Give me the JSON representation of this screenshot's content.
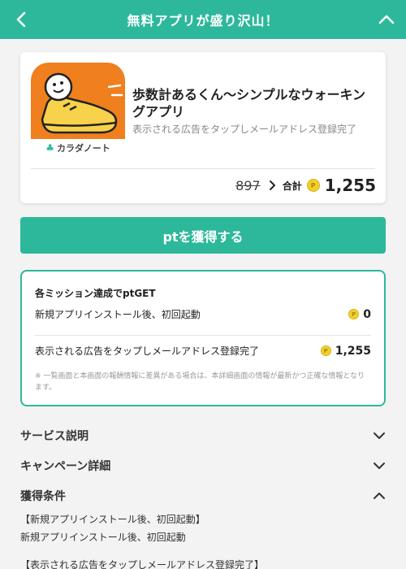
{
  "header": {
    "title": "無料アプリが盛り沢山！"
  },
  "app": {
    "name": "歩数計あるくん〜シンプルなウォーキングアプリ",
    "subtitle": "表示される広告をタップしメールアドレス登録完了",
    "brand": "カラダノート",
    "old_points": "897",
    "total_label": "合計",
    "total_points": "1,255",
    "coin_symbol": "P"
  },
  "get_button": {
    "label": "ptを獲得する"
  },
  "missions": {
    "title": "各ミッション達成でptGET",
    "items": [
      {
        "label": "新規アプリインストール後、初回起動",
        "points": "0"
      },
      {
        "label": "表示される広告をタップしメールアドレス登録完了",
        "points": "1,255"
      }
    ],
    "note": "※ 一覧画面と本画面の報酬情報に差異がある場合は、本詳細画面の情報が最新かつ正確な情報となります。"
  },
  "sections": {
    "service": "サービス説明",
    "campaign": "キャンペーン詳細",
    "conditions": "獲得条件"
  },
  "conditions": {
    "line1": "【新規アプリインストール後、初回起動】",
    "line2": "新規アプリインストール後、初回起動",
    "line3": "【表示される広告をタップしメールアドレス登録完了】"
  },
  "colors": {
    "accent": "#2db89b",
    "icon_orange": "#f07f1e",
    "coin": "#f2cf2b"
  },
  "icons": {
    "back": "chevron-left-icon",
    "collapse": "chevron-up-icon",
    "expand": "chevron-down-icon"
  }
}
